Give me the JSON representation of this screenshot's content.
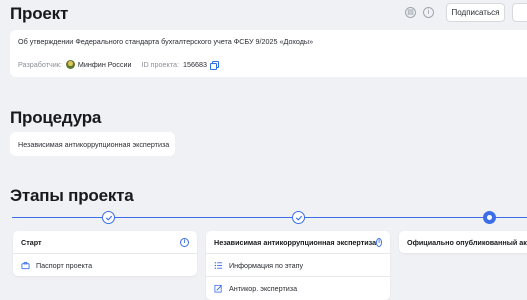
{
  "project": {
    "heading": "Проект",
    "subscribe_label": "Подписаться",
    "title": "Об утверждении Федерального стандарта бухгалтерского учета ФСБУ 9/2025 «Доходы»",
    "developer_label": "Разработчик:",
    "developer_value": "Минфин России",
    "id_label": "ID проекта:",
    "id_value": "156683"
  },
  "procedure": {
    "heading": "Процедура",
    "value": "Независимая антикоррупционная экспертиза"
  },
  "stages": {
    "heading": "Этапы проекта",
    "steps": [
      {
        "status": "completed"
      },
      {
        "status": "completed"
      },
      {
        "status": "active"
      }
    ],
    "cards": [
      {
        "title": "Старт",
        "items": [
          {
            "label": "Паспорт проекта",
            "icon": "briefcase-icon"
          }
        ]
      },
      {
        "title": "Независимая антикоррупционная экспертиза",
        "items": [
          {
            "label": "Информация по этапу",
            "icon": "list-icon"
          },
          {
            "label": "Антикор. экспертиза",
            "icon": "edit-document-icon"
          }
        ]
      },
      {
        "title": "Официально опубликованный акт",
        "items": []
      }
    ]
  },
  "colors": {
    "accent": "#3b6ee8",
    "background": "#f0f1f4",
    "card": "#ffffff"
  }
}
